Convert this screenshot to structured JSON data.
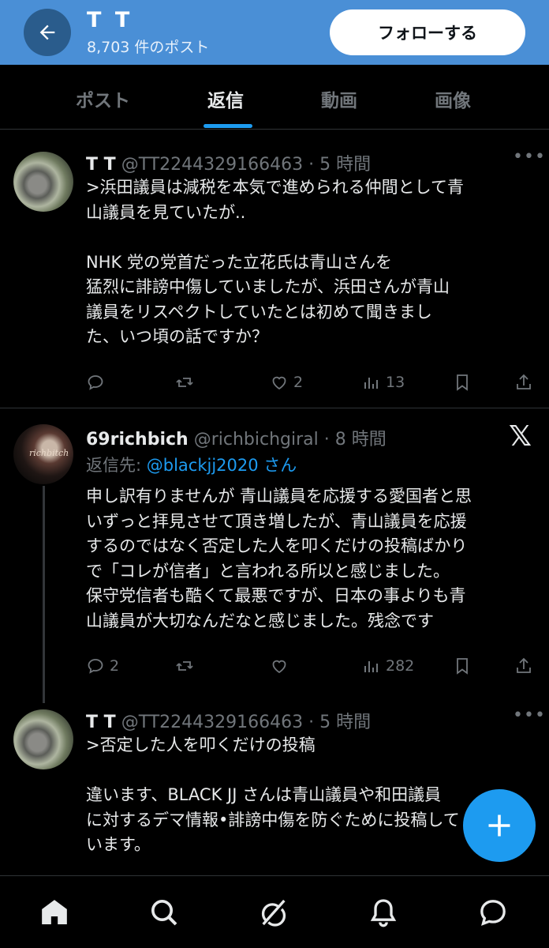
{
  "header": {
    "title": "T T",
    "post_count": "8,703 件のポスト",
    "follow_label": "フォローする"
  },
  "tabs": [
    "ポスト",
    "返信",
    "動画",
    "画像"
  ],
  "active_tab": "返信",
  "posts": [
    {
      "name": "T T",
      "handle": "@TT2244329166463 · 5 時間",
      "lines": [
        ">浜田議員は減税を本気で進められる仲間として青",
        "山議員を見ていたが..",
        "",
        "NHK 党の党首だった立花氏は青山さんを",
        "猛烈に誹謗中傷していましたが、浜田さんが青山",
        "議員をリスペクトしていたとは初めて聞きまし",
        "た、いつ頃の話ですか？"
      ],
      "likes": "2",
      "views": "13",
      "replies": "",
      "retweets": ""
    },
    {
      "name": "69richbich",
      "handle": "@richbichgiral · 8 時間",
      "avatar_text": "richbitch",
      "reply_to_prefix": "返信先: ",
      "reply_to_mention": "@blackjj2020 さん",
      "lines": [
        "申し訳有りませんが 青山議員を応援する愛国者と思",
        "いずっと拝見させて頂き増したが、青山議員を応援",
        "するのではなく否定した人を叩くだけの投稿ばかり",
        "で「コレが信者」と言われる所以と感じました。",
        "保守党信者も酷くて最悪ですが、日本の事よりも青",
        "山議員が大切なんだなと感じました。残念です"
      ],
      "replies": "2",
      "likes": "",
      "views": "282",
      "retweets": ""
    },
    {
      "name": "T T",
      "handle": "@TT2244329166463 · 5 時間",
      "lines": [
        ">否定した人を叩くだけの投稿",
        "",
        "違います、BLACK JJ さんは青山議員や和田議員",
        "に対するデマ情報•誹謗中傷を防ぐために投稿して",
        "います。"
      ]
    }
  ],
  "icons": {
    "back": "arrow-left-icon",
    "more": "more-icon",
    "reply": "reply-icon",
    "retweet": "retweet-icon",
    "like": "heart-icon",
    "views": "views-icon",
    "bookmark": "bookmark-icon",
    "share": "share-icon",
    "x_logo": "x-logo-icon",
    "compose": "plus-icon",
    "nav": [
      "home-icon",
      "search-icon",
      "grok-icon",
      "bell-icon",
      "message-icon"
    ]
  },
  "colors": {
    "header_bg": "#4a8fd6",
    "accent": "#1d9bf0",
    "muted": "#71767b",
    "text": "#e7e9ea",
    "background": "#000000"
  }
}
